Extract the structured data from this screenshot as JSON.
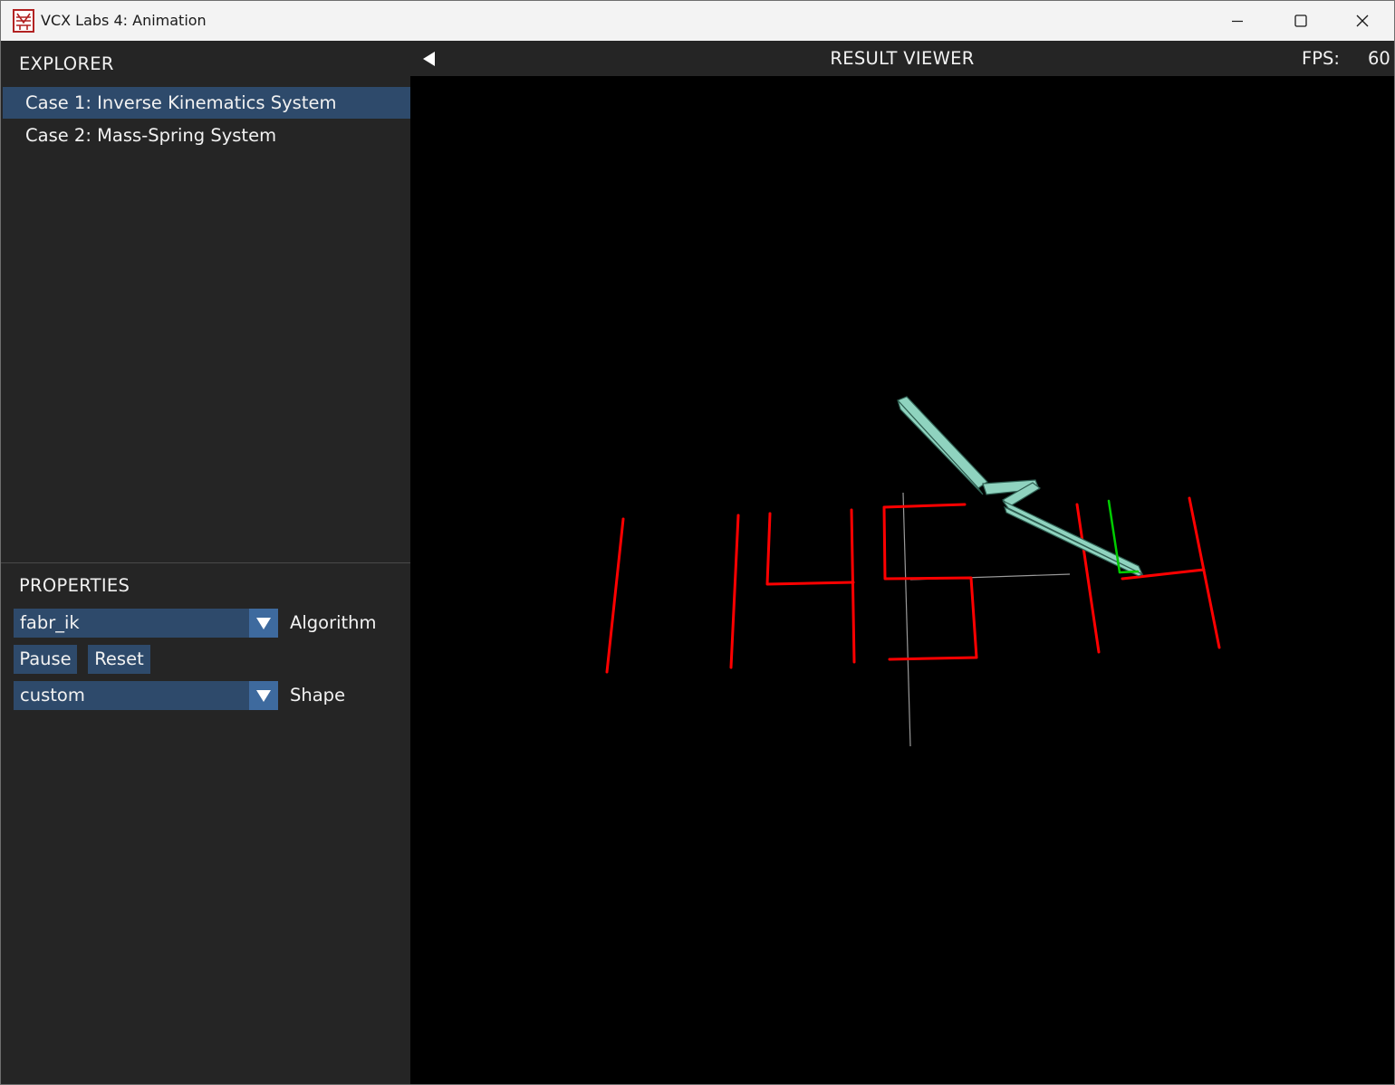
{
  "window": {
    "title": "VCX Labs 4: Animation",
    "icon": "vcx-app-icon",
    "controls": [
      "minimize-icon",
      "maximize-icon",
      "close-icon"
    ]
  },
  "explorer": {
    "header": "EXPLORER",
    "items": [
      {
        "label": "Case 1: Inverse Kinematics System",
        "selected": true
      },
      {
        "label": "Case 2: Mass-Spring System",
        "selected": false
      }
    ]
  },
  "properties": {
    "header": "PROPERTIES",
    "algorithm": {
      "value": "fabr_ik",
      "label": "Algorithm"
    },
    "buttons": {
      "pause": "Pause",
      "reset": "Reset"
    },
    "shape": {
      "value": "custom",
      "label": "Shape"
    }
  },
  "viewer": {
    "title": "RESULT VIEWER",
    "fps_label": "FPS:",
    "fps_value": "60"
  },
  "colors": {
    "accent": "#2e4a6b",
    "accent_light": "#3e6a9e",
    "panel": "#252525",
    "viewport": "#000000",
    "target_curve": "#ff0000",
    "ik_bones": "#8fd3bf",
    "end_effector_axis": "#00cc00",
    "world_axes": "#aaaaaa"
  }
}
